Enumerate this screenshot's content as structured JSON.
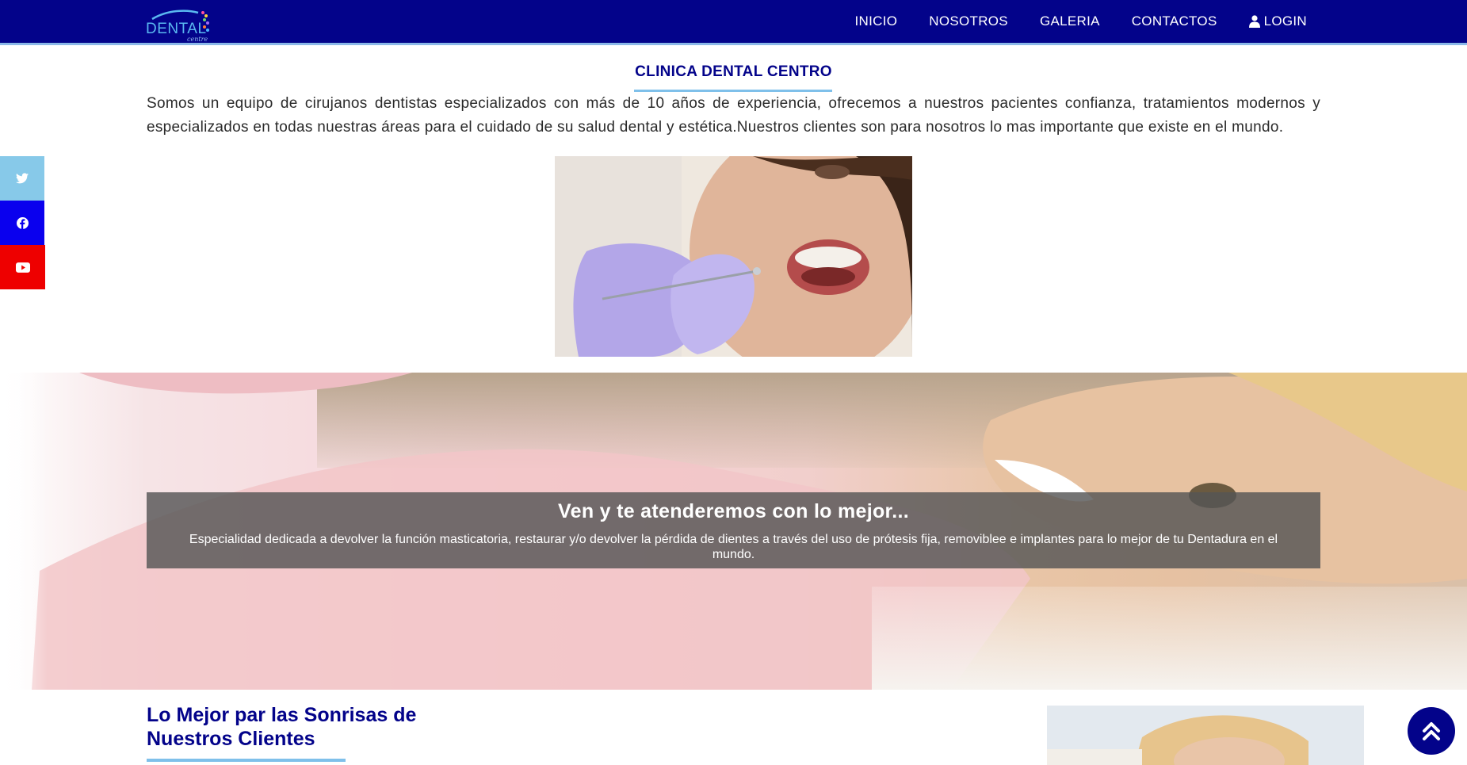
{
  "brand": {
    "name": "DENTAL",
    "tagline": "centre"
  },
  "nav": {
    "items": [
      "INICIO",
      "NOSOTROS",
      "GALERIA",
      "CONTACTOS"
    ],
    "login": "LOGIN"
  },
  "social": {
    "twitter": "twitter-icon",
    "facebook": "facebook-icon",
    "youtube": "youtube-icon"
  },
  "intro": {
    "title": "CLINICA DENTAL CENTRO",
    "text": "Somos un equipo de cirujanos dentistas especializados con más de 10 años de experiencia, ofrecemos a nuestros pacientes confianza, tratamientos modernos y especializados en todas nuestras áreas para el cuidado de su salud dental y estética.Nuestros clientes son para nosotros lo mas importante que existe en el mundo."
  },
  "hero": {
    "title": "Ven y te atenderemos con lo mejor...",
    "text": "Especialidad dedicada a devolver la función masticatoria, restaurar y/o devolver la pérdida de dientes a través del uso de prótesis fija, removiblee e implantes para lo mejor de tu Dentadura en el mundo."
  },
  "section2": {
    "title": "Lo Mejor par las Sonrisas de Nuestros Clientes"
  },
  "colors": {
    "navbar": "#03038a",
    "accent": "#7fc0ea",
    "twitter": "#87c9e9",
    "facebook": "#0a00ee",
    "youtube": "#ee0000"
  }
}
